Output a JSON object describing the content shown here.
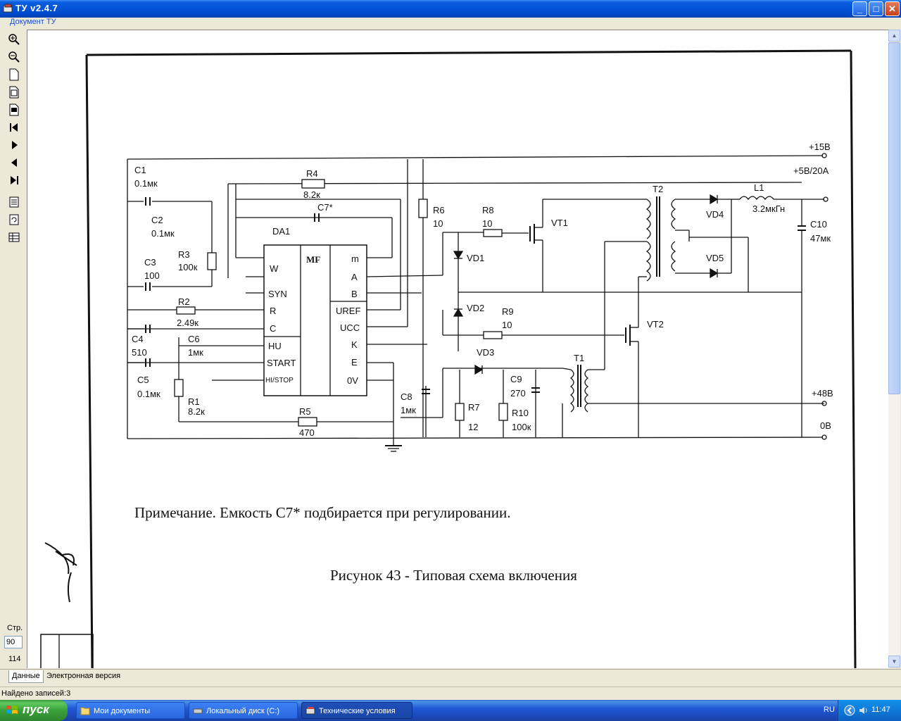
{
  "window": {
    "title": "ТУ  v2.4.7",
    "minimize": "_",
    "maximize": "□",
    "close": "✕"
  },
  "menu": {
    "document": "Документ ТУ"
  },
  "toolbar": {
    "icons": [
      "zoom-in-icon",
      "zoom-out-icon",
      "page-icon",
      "page-width-icon",
      "page-fit-icon",
      "first-page-icon",
      "next-page-icon",
      "prev-page-icon",
      "last-page-icon",
      "doc-list-icon",
      "doc-refresh-icon",
      "doc-table-icon"
    ],
    "page_label": "Стр.",
    "page_value": "90",
    "page_total": "114"
  },
  "document": {
    "note": "Примечание. Емкость С7* подбирается при регулировании.",
    "caption": "Рисунок 43 - Типовая схема включения",
    "schematic_labels": {
      "p15v": "+15В",
      "p5v": "+5В/20А",
      "p48v": "+48В",
      "zero": "0В",
      "c1": "C1",
      "c1v": "0.1мк",
      "c2": "C2",
      "c2v": "0.1мк",
      "c3": "C3",
      "c3v": "100",
      "c4": "C4",
      "c4v": "510",
      "c5": "C5",
      "c5v": "0.1мк",
      "c6": "C6",
      "c6v": "1мк",
      "c7": "C7*",
      "c8": "C8",
      "c8v": "1мк",
      "c9": "C9",
      "c9v": "270",
      "c10": "C10",
      "c10v": "47мк",
      "r1": "R1",
      "r1v": "8.2к",
      "r2": "R2",
      "r2v": "2.49к",
      "r3": "R3",
      "r3v": "100к",
      "r4": "R4",
      "r4v": "8.2к",
      "r5": "R5",
      "r5v": "470",
      "r6": "R6",
      "r6v": "10",
      "r7": "R7",
      "r7v": "12",
      "r8": "R8",
      "r8v": "10",
      "r9": "R9",
      "r9v": "10",
      "r10": "R10",
      "r10v": "100к",
      "da1": "DA1",
      "mf": "MF",
      "pin_w": "W",
      "pin_syn": "SYN",
      "pin_r": "R",
      "pin_c": "C",
      "pin_hu": "HU",
      "pin_start": "START",
      "pin_histop": "HI/STOP",
      "pin_m": "m",
      "pin_a": "A",
      "pin_b": "B",
      "pin_uref": "UREF",
      "pin_ucc": "UCC",
      "pin_k": "K",
      "pin_e": "E",
      "pin_0v": "0V",
      "vt1": "VT1",
      "vt2": "VT2",
      "vd1": "VD1",
      "vd2": "VD2",
      "vd3": "VD3",
      "vd4": "VD4",
      "vd5": "VD5",
      "t1": "T1",
      "t2": "T2",
      "l1": "L1",
      "l1v": "3.2мкГн"
    }
  },
  "tabs": [
    "Данные",
    "Электронная версия"
  ],
  "status": "Найдено записей:3",
  "taskbar": {
    "start": "пуск",
    "tasks": [
      "Мои документы",
      "Локальный диск (C:)",
      "Технические условия"
    ],
    "lang": "RU",
    "clock": "11:47"
  }
}
